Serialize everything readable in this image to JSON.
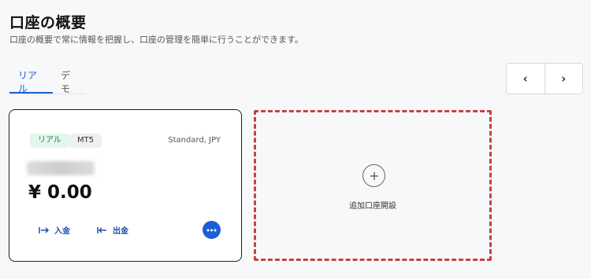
{
  "header": {
    "title": "口座の概要",
    "subtitle": "口座の概要で常に情報を把握し、口座の管理を簡単に行うことができます。"
  },
  "tabs": [
    {
      "label": "リアル",
      "active": true
    },
    {
      "label": "デモ",
      "active": false
    }
  ],
  "pager": {
    "prev_label": "‹",
    "next_label": "›"
  },
  "account_card": {
    "badges": [
      "リアル",
      "MT5"
    ],
    "account_type": "Standard, JPY",
    "balance": "¥ 0.00",
    "deposit_label": "入金",
    "withdraw_label": "出金"
  },
  "add_account": {
    "label": "追加口座開設"
  },
  "colors": {
    "accent": "#1b5fd6",
    "dashed_border": "#c7423f",
    "badge_real_bg": "#e2f6ec"
  }
}
